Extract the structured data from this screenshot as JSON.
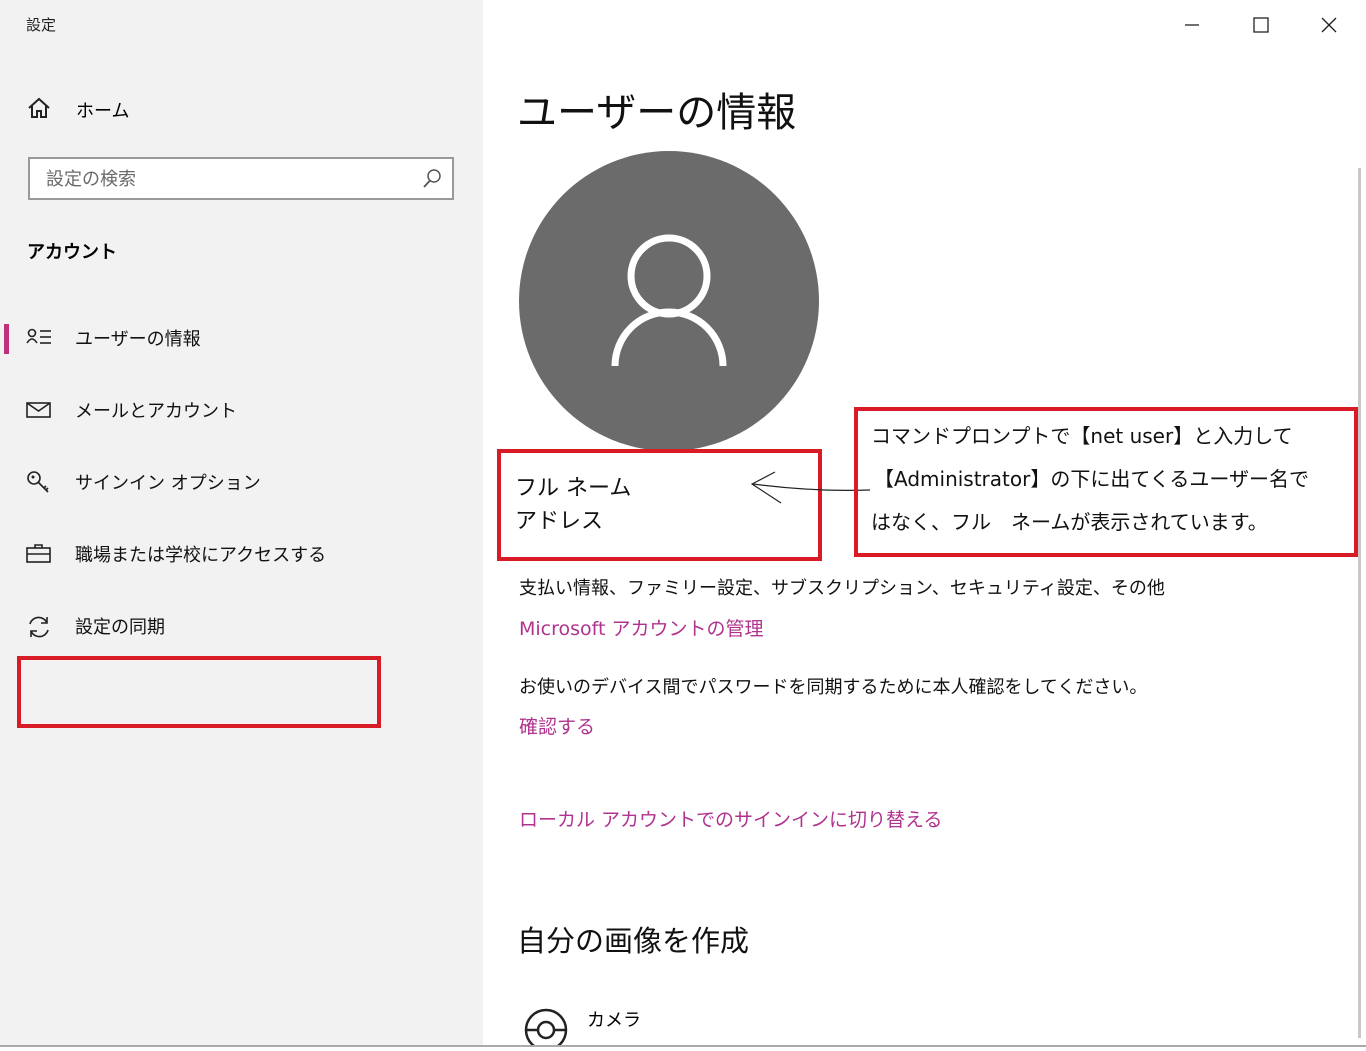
{
  "window": {
    "title": "設定"
  },
  "sidebar": {
    "home_label": "ホーム",
    "search_placeholder": "設定の検索",
    "section_title": "アカウント",
    "items": [
      {
        "label": "ユーザーの情報",
        "icon": "person-list-icon",
        "selected": true
      },
      {
        "label": "メールとアカウント",
        "icon": "mail-icon",
        "selected": false
      },
      {
        "label": "サインイン オプション",
        "icon": "key-icon",
        "selected": false
      },
      {
        "label": "職場または学校にアクセスする",
        "icon": "briefcase-icon",
        "selected": false
      },
      {
        "label": "設定の同期",
        "icon": "sync-icon",
        "selected": false
      }
    ]
  },
  "main": {
    "title": "ユーザーの情報",
    "user": {
      "full_name": "フル ネーム",
      "address": "アドレス"
    },
    "annotation": {
      "lines": [
        "コマンドプロンプトで【net user】と入力して",
        "【Administrator】の下に出てくるユーザー名で",
        "はなく、フル　ネームが表示されています。"
      ],
      "color": "#d81b25"
    },
    "billing_text": "支払い情報、ファミリー設定、サブスクリプション、セキュリティ設定、その他",
    "manage_link": "Microsoft アカウントの管理",
    "verify_text": "お使いのデバイス間でパスワードを同期するために本人確認をしてください。",
    "verify_link": "確認する",
    "local_link": "ローカル アカウントでのサインインに切り替える",
    "create_picture_title": "自分の画像を作成",
    "camera_label": "カメラ"
  },
  "colors": {
    "accent": "#c0307a",
    "link": "#b0338f",
    "annotation_red": "#d81b25",
    "avatar": "#6b6b6b"
  }
}
